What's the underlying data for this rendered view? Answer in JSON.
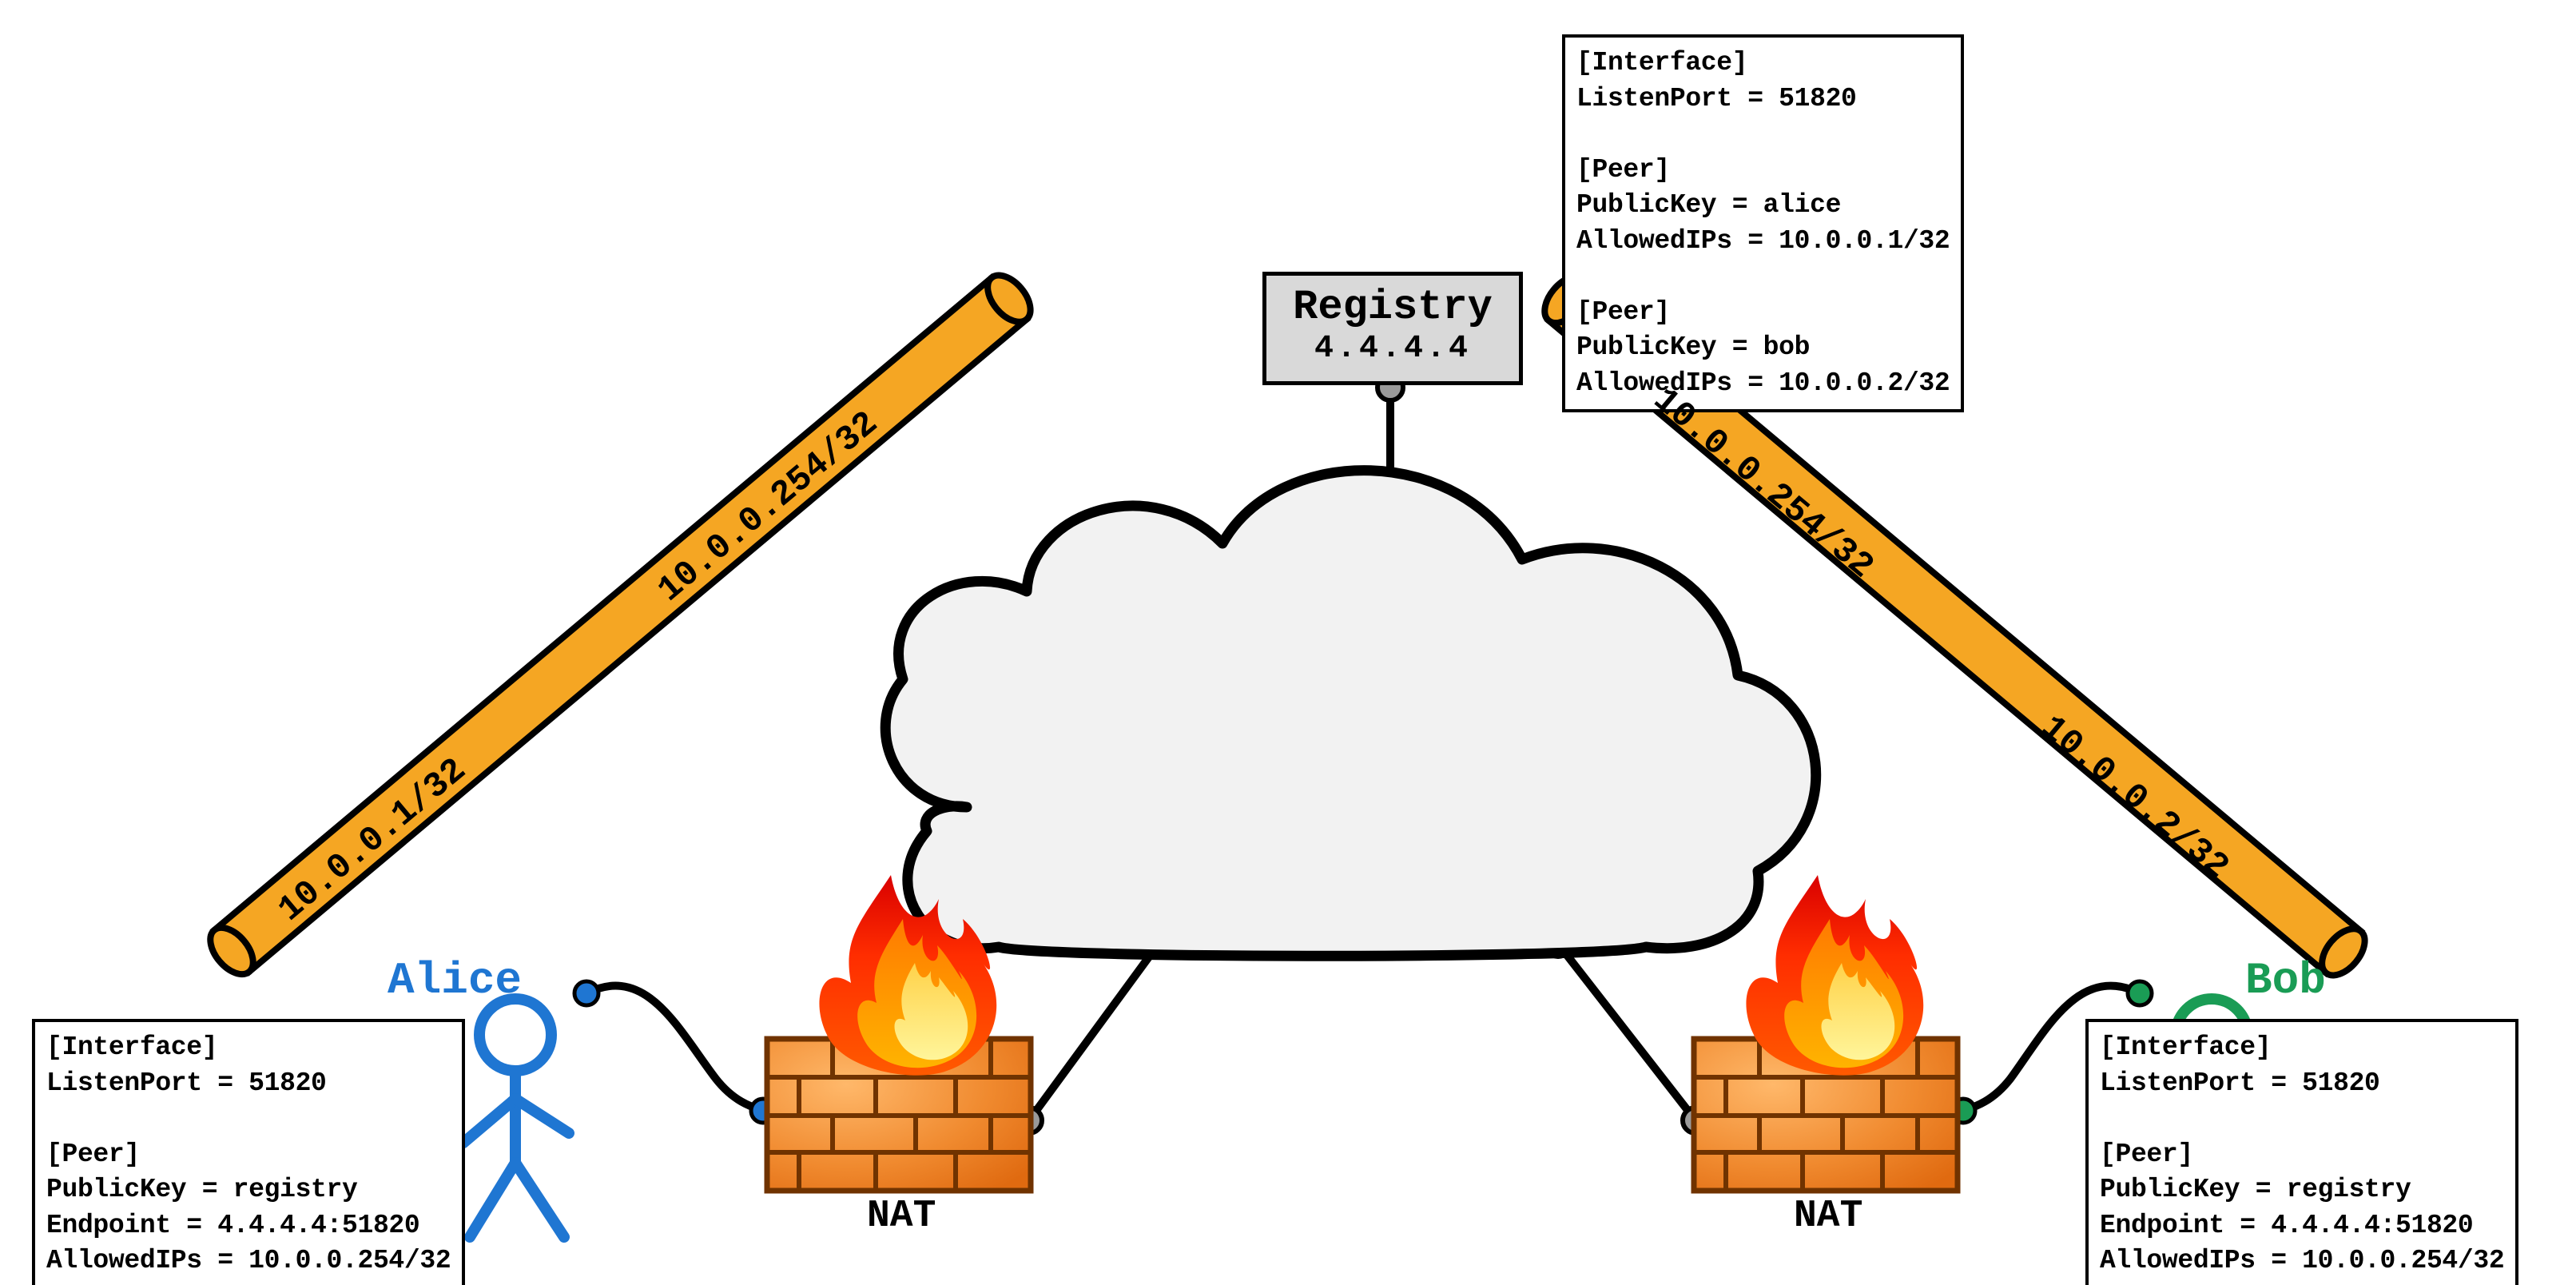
{
  "registry": {
    "title": "Registry",
    "ip": "4.4.4.4",
    "config": "[Interface]\nListenPort = 51820\n\n[Peer]\nPublicKey = alice\nAllowedIPs = 10.0.0.1/32\n\n[Peer]\nPublicKey = bob\nAllowedIPs = 10.0.0.2/32"
  },
  "alice": {
    "name": "Alice",
    "color": "#1f76d2",
    "config": "[Interface]\nListenPort = 51820\n\n[Peer]\nPublicKey = registry\nEndpoint = 4.4.4.4:51820\nAllowedIPs = 10.0.0.254/32"
  },
  "bob": {
    "name": "Bob",
    "color": "#1a9c55",
    "config": "[Interface]\nListenPort = 51820\n\n[Peer]\nPublicKey = registry\nEndpoint = 4.4.4.4:51820\nAllowedIPs = 10.0.0.254/32"
  },
  "nat": {
    "label_left": "NAT",
    "label_right": "NAT"
  },
  "tubes": {
    "left_outer": "10.0.0.254/32",
    "left_inner": "10.0.0.1/32",
    "right_outer": "10.0.0.254/32",
    "right_inner": "10.0.0.2/32"
  }
}
